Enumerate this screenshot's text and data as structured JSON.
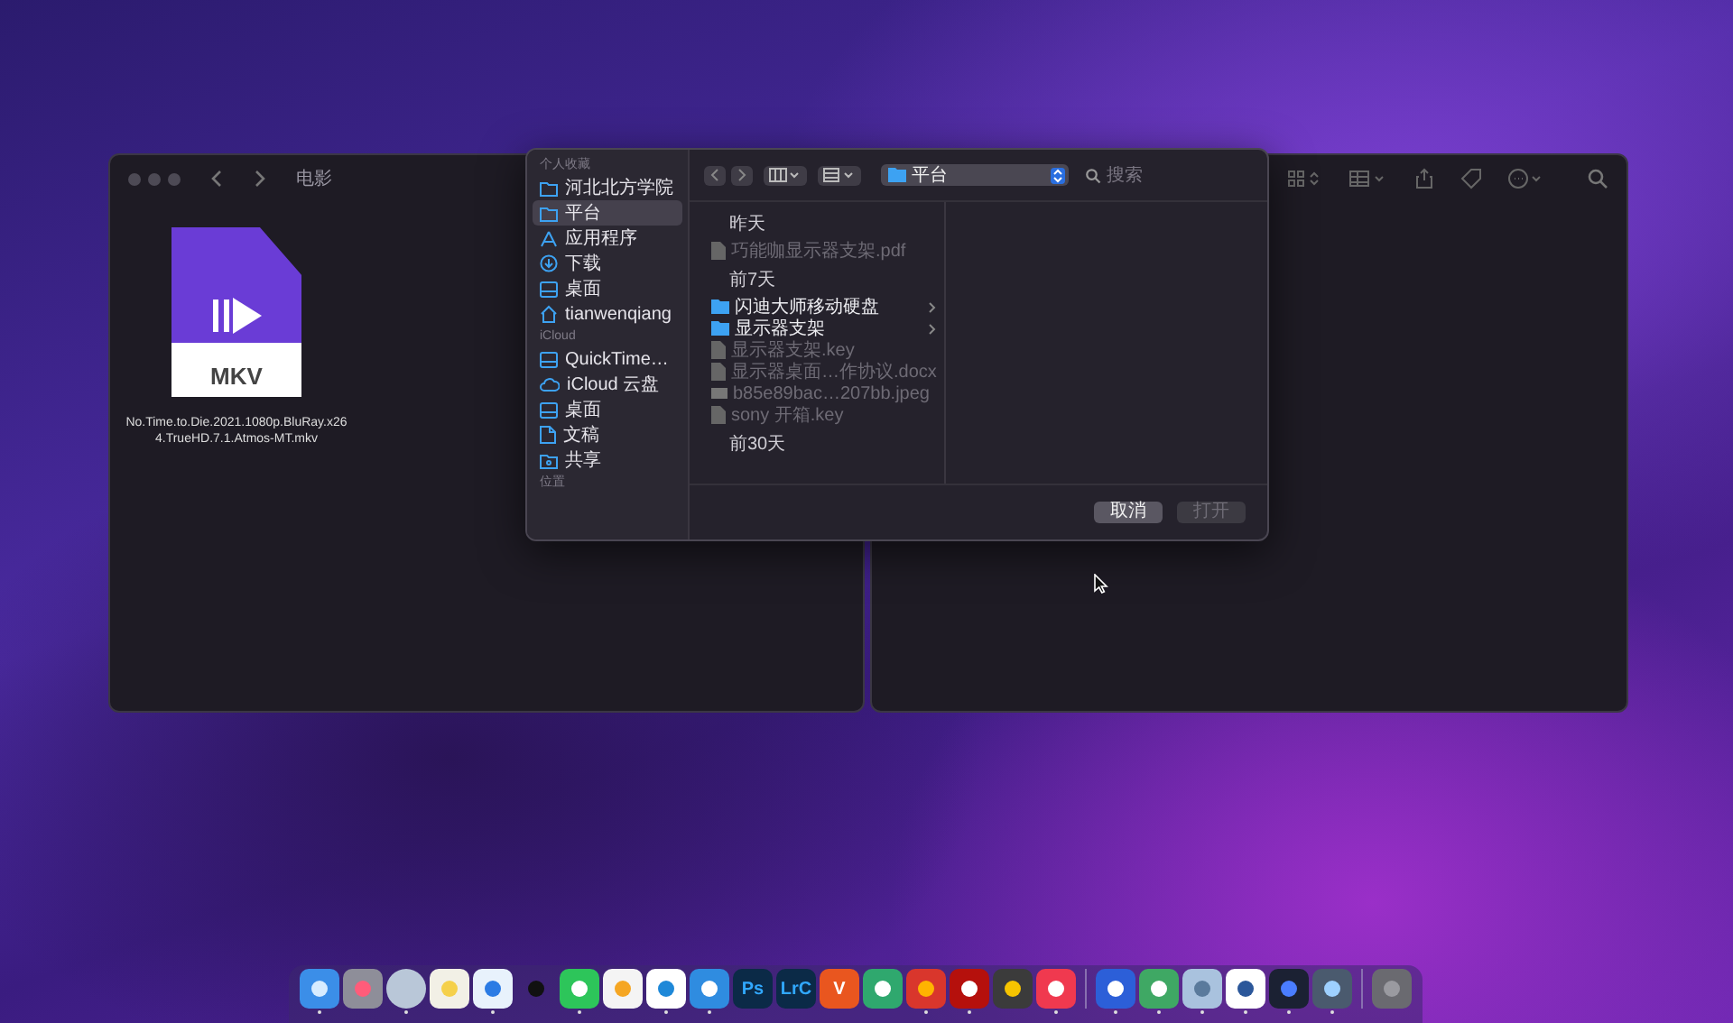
{
  "finder_window": {
    "title": "电影",
    "files": [
      {
        "name": "No.Time.to.Die.2021.1080p.BluRay.x264.TrueHD.7.1.Atmos-MT.mkv",
        "type_label": "MKV"
      }
    ]
  },
  "dialog": {
    "sidebar": [
      {
        "heading": "个人收藏",
        "items": [
          {
            "label": "河北北方学院",
            "kind": "folder",
            "selected": false
          },
          {
            "label": "平台",
            "kind": "folder",
            "selected": true
          },
          {
            "label": "应用程序",
            "kind": "apps",
            "selected": false
          },
          {
            "label": "下载",
            "kind": "download",
            "selected": false
          },
          {
            "label": "桌面",
            "kind": "desktop",
            "selected": false
          },
          {
            "label": "tianwenqiang",
            "kind": "home",
            "selected": false
          }
        ]
      },
      {
        "heading": "iCloud",
        "items": [
          {
            "label": "QuickTime…",
            "kind": "desktop",
            "selected": false
          },
          {
            "label": "iCloud 云盘",
            "kind": "cloud",
            "selected": false
          },
          {
            "label": "桌面",
            "kind": "desktop",
            "selected": false
          },
          {
            "label": "文稿",
            "kind": "document",
            "selected": false
          },
          {
            "label": "共享",
            "kind": "shared",
            "selected": false
          }
        ]
      },
      {
        "heading": "位置"
      }
    ],
    "path": "平台",
    "search": {
      "placeholder": "搜索"
    },
    "groups": [
      {
        "heading": "昨天",
        "files": [
          {
            "name": "巧能咖显示器支架.pdf",
            "kind": "document",
            "disabled": true
          }
        ]
      },
      {
        "heading": "前7天",
        "files": [
          {
            "name": "闪迪大师移动硬盘",
            "kind": "folder",
            "disabled": false
          },
          {
            "name": "显示器支架",
            "kind": "folder",
            "disabled": false
          },
          {
            "name": "显示器支架.key",
            "kind": "document",
            "disabled": true
          },
          {
            "name": "显示器桌面…作协议.docx",
            "kind": "document",
            "disabled": true
          },
          {
            "name": "b85e89bac…207bb.jpeg",
            "kind": "image",
            "disabled": true
          },
          {
            "name": "sony 开箱.key",
            "kind": "document",
            "disabled": true
          }
        ]
      },
      {
        "heading": "前30天"
      }
    ],
    "buttons": [
      {
        "label": "取消",
        "disabled": false
      },
      {
        "label": "打开",
        "disabled": true
      }
    ]
  },
  "dock": {
    "sections": [
      {
        "apps": [
          {
            "kind": "finder",
            "running": true
          },
          {
            "kind": "launchpad",
            "running": false
          },
          {
            "kind": "avatar",
            "running": true
          },
          {
            "kind": "notes",
            "running": false
          },
          {
            "kind": "safari",
            "running": true
          },
          {
            "kind": "penguin",
            "running": false
          },
          {
            "kind": "chat",
            "running": true
          },
          {
            "kind": "photos",
            "running": false
          },
          {
            "kind": "edge",
            "running": true
          },
          {
            "kind": "keynote",
            "running": true
          },
          {
            "kind": "ps",
            "label": "Ps",
            "running": false
          },
          {
            "kind": "lrc",
            "label": "LrC",
            "running": false
          },
          {
            "kind": "v",
            "label": "V",
            "running": false
          },
          {
            "kind": "horse",
            "running": false
          },
          {
            "kind": "cross",
            "running": true
          },
          {
            "kind": "acrobat",
            "running": true
          },
          {
            "kind": "clapper",
            "running": false
          },
          {
            "kind": "music",
            "running": true
          }
        ]
      },
      {
        "apps": [
          {
            "kind": "bluebox",
            "running": true
          },
          {
            "kind": "panda",
            "running": true
          },
          {
            "kind": "preview",
            "running": true
          },
          {
            "kind": "word",
            "running": true
          },
          {
            "kind": "video",
            "running": true
          },
          {
            "kind": "quicktime",
            "running": true
          }
        ]
      },
      {
        "apps": [
          {
            "kind": "trash",
            "running": false
          }
        ]
      }
    ]
  }
}
